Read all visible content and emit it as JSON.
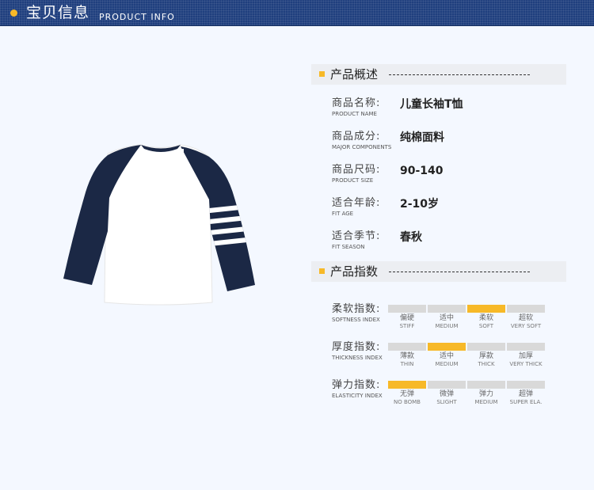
{
  "header": {
    "title": "宝贝信息",
    "subtitle": "PRODUCT INFO"
  },
  "colors": {
    "header_bg": "#1f3f7e",
    "accent": "#f7b928",
    "bar_off": "#d9d9d9"
  },
  "overview": {
    "title": "产品概述",
    "items": [
      {
        "cn": "商品名称:",
        "en": "PRODUCT NAME",
        "value": "儿童长袖T恤"
      },
      {
        "cn": "商品成分:",
        "en": "MAJOR COMPONENTS",
        "value": "纯棉面料"
      },
      {
        "cn": "商品尺码:",
        "en": "PRODUCT SIZE",
        "value": "90-140"
      },
      {
        "cn": "适合年龄:",
        "en": "FIT AGE",
        "value": "2-10岁"
      },
      {
        "cn": "适合季节:",
        "en": "FIT SEASON",
        "value": "春秋"
      }
    ]
  },
  "index": {
    "title": "产品指数",
    "rows": [
      {
        "cn": "柔软指数:",
        "en": "SOFTNESS INDEX",
        "selected": 2,
        "levels": [
          {
            "cn": "偏硬",
            "en": "STIFF"
          },
          {
            "cn": "适中",
            "en": "MEDIUM"
          },
          {
            "cn": "柔软",
            "en": "SOFT"
          },
          {
            "cn": "超软",
            "en": "VERY SOFT"
          }
        ]
      },
      {
        "cn": "厚度指数:",
        "en": "THICKNESS INDEX",
        "selected": 1,
        "levels": [
          {
            "cn": "薄款",
            "en": "THIN"
          },
          {
            "cn": "适中",
            "en": "MEDIUM"
          },
          {
            "cn": "厚款",
            "en": "THICK"
          },
          {
            "cn": "加厚",
            "en": "VERY THICK"
          }
        ]
      },
      {
        "cn": "弹力指数:",
        "en": "ELASTICITY INDEX",
        "selected": 0,
        "levels": [
          {
            "cn": "无弹",
            "en": "NO BOMB"
          },
          {
            "cn": "微弹",
            "en": "SLIGHT"
          },
          {
            "cn": "弹力",
            "en": "MEDIUM"
          },
          {
            "cn": "超弹",
            "en": "SUPER ELA."
          }
        ]
      }
    ]
  },
  "icons": {
    "product": "raglan-long-sleeve-tshirt"
  }
}
